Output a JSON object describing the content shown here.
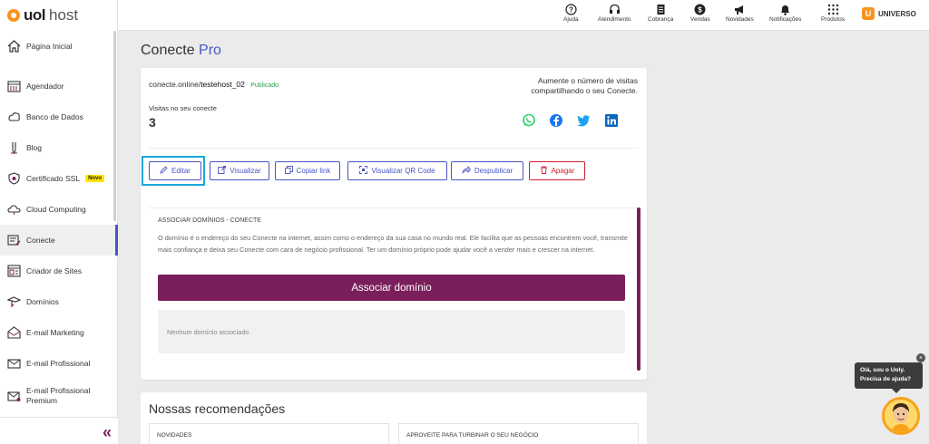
{
  "brand": {
    "logo_uol": "uol",
    "logo_host": "host",
    "accent": "#4a54c5",
    "primary": "#7b1f5c"
  },
  "sidebar": {
    "items": [
      {
        "label": "Página Inicial",
        "icon": "home-icon"
      },
      {
        "label": "Agendador",
        "icon": "calendar-icon"
      },
      {
        "label": "Banco de Dados",
        "icon": "database-icon"
      },
      {
        "label": "Blog",
        "icon": "pen-icon"
      },
      {
        "label": "Certificado SSL",
        "icon": "certificate-icon",
        "badge": "Novo"
      },
      {
        "label": "Cloud Computing",
        "icon": "cloud-icon"
      },
      {
        "label": "Conecte",
        "icon": "conecte-icon",
        "active": true
      },
      {
        "label": "Criador de Sites",
        "icon": "site-builder-icon"
      },
      {
        "label": "Domínios",
        "icon": "domain-icon"
      },
      {
        "label": "E-mail Marketing",
        "icon": "email-marketing-icon"
      },
      {
        "label": "E-mail Profissional",
        "icon": "email-icon"
      },
      {
        "label": "E-mail Profissional Premium",
        "icon": "email-premium-icon"
      }
    ],
    "collapse_label": "«"
  },
  "topbar": {
    "items": [
      {
        "label": "Ajuda",
        "icon": "help-icon"
      },
      {
        "label": "Atendimento",
        "icon": "headset-icon"
      },
      {
        "label": "Cobrança",
        "icon": "invoice-icon"
      },
      {
        "label": "Vendas",
        "icon": "sales-icon"
      },
      {
        "label": "Novidades",
        "icon": "megaphone-icon"
      },
      {
        "label": "Notificações",
        "icon": "bell-icon"
      },
      {
        "label": "Produtos",
        "icon": "grid-icon"
      }
    ],
    "user": {
      "initial": "U",
      "name": "UNIVERSO"
    }
  },
  "page": {
    "title": "Conecte",
    "title_accent": "Pro"
  },
  "conecte": {
    "url_domain": "conecte.online/",
    "url_slug": "testehost_02",
    "status": "Publicado",
    "visits_label": "Visitas no seu conecte",
    "visits": "3",
    "share_text": "Aumente o número de visitas compartilhando o seu Conecte.",
    "social": [
      "whatsapp-icon",
      "facebook-icon",
      "twitter-icon",
      "linkedin-icon"
    ]
  },
  "actions": {
    "edit": "Editar",
    "view": "Visualizar",
    "copy": "Copiar link",
    "qr": "Visualizar QR Code",
    "unpublish": "Despublicar",
    "delete": "Apagar"
  },
  "domains": {
    "title": "ASSOCIAR DOMÍNIOS - CONECTE",
    "text": "O domínio é o endereço do seu Conecte na internet, assim como o endereço da sua casa no mundo real. Ele facilita que as pessoas encontrem você, transmite mais confiança e deixa seu Conecte com cara de negócio profissional. Ter um domínio próprio pode ajudar você a vender mais e crescer na internet.",
    "button": "Associar domínio",
    "empty": "Nenhum domínio associado"
  },
  "recommendations": {
    "title": "Nossas recomendações",
    "col1": "NOVIDADES",
    "col2": "APROVEITE PARA TURBINAR O SEU NEGÓCIO"
  },
  "chat": {
    "line1": "Olá, sou o Uoly.",
    "line2": "Precisa de ajuda?",
    "close": "×"
  }
}
